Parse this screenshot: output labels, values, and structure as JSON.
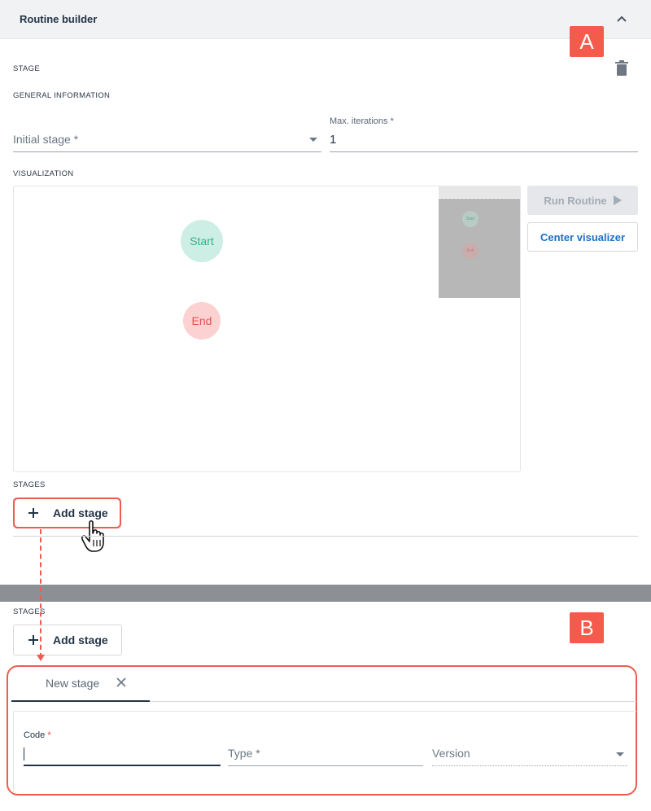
{
  "header": {
    "title": "Routine builder"
  },
  "badges": {
    "a": "A",
    "b": "B"
  },
  "stage_section": {
    "label": "STAGE",
    "general_info_label": "GENERAL INFORMATION",
    "initial_stage": {
      "placeholder": "Initial stage *"
    },
    "max_iterations": {
      "label": "Max. iterations *",
      "value": "1"
    }
  },
  "visualization": {
    "label": "VISUALIZATION",
    "nodes": {
      "start": "Start",
      "end": "End"
    },
    "minimap": {
      "start": "Start",
      "end": "End"
    },
    "run_button": "Run Routine",
    "center_button": "Center visualizer"
  },
  "stages_top": {
    "label": "STAGES",
    "add_button": "Add stage"
  },
  "stages_bottom": {
    "label": "STAGES",
    "add_button": "Add stage",
    "tab": {
      "label": "New stage"
    },
    "form": {
      "code_label": "Code",
      "code_required": "*",
      "type_placeholder": "Type *",
      "version_placeholder": "Version"
    }
  },
  "colors": {
    "highlight": "#ec5d4f",
    "badge": "#f45b4c",
    "start_node": "#cdeee4",
    "end_node": "#fbd1d1",
    "link": "#1d6fc4"
  }
}
